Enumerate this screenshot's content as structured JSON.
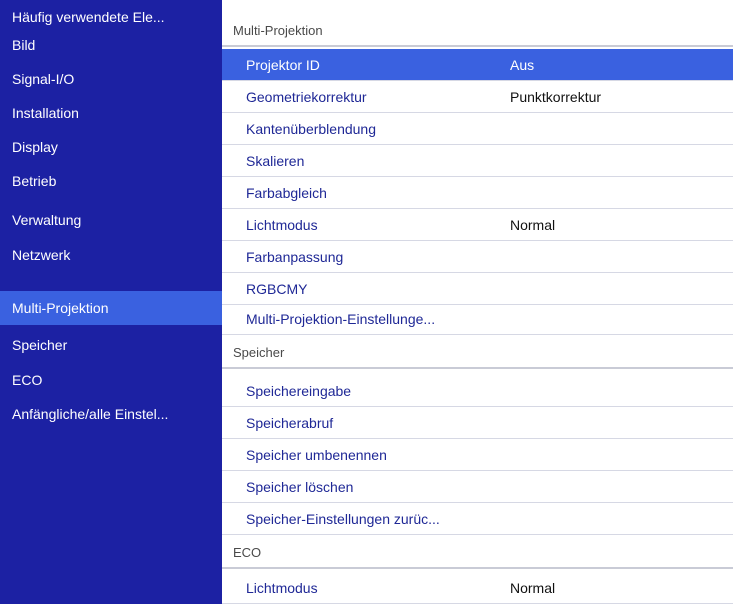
{
  "sidebar": {
    "items": [
      {
        "label": "Häufig verwendete Ele..."
      },
      {
        "label": "Bild"
      },
      {
        "label": "Signal-I/O"
      },
      {
        "label": "Installation"
      },
      {
        "label": "Display"
      },
      {
        "label": "Betrieb"
      },
      {
        "label": "Verwaltung"
      },
      {
        "label": "Netzwerk"
      },
      {
        "label": "Multi-Projektion",
        "active": true
      },
      {
        "label": "Speicher"
      },
      {
        "label": "ECO"
      },
      {
        "label": "Anfängliche/alle Einstel..."
      }
    ]
  },
  "main": {
    "sections": [
      {
        "title": "Multi-Projektion",
        "items": [
          {
            "label": "Projektor ID",
            "value": "Aus",
            "selected": true
          },
          {
            "label": "Geometriekorrektur",
            "value": "Punktkorrektur"
          },
          {
            "label": "Kantenüberblendung",
            "value": ""
          },
          {
            "label": "Skalieren",
            "value": ""
          },
          {
            "label": "Farbabgleich",
            "value": ""
          },
          {
            "label": "Lichtmodus",
            "value": "Normal"
          },
          {
            "label": "Farbanpassung",
            "value": ""
          },
          {
            "label": "RGBCMY",
            "value": ""
          },
          {
            "label": "Multi-Projektion-Einstellunge...",
            "value": ""
          }
        ]
      },
      {
        "title": "Speicher",
        "items": [
          {
            "label": "Speichereingabe",
            "value": ""
          },
          {
            "label": "Speicherabruf",
            "value": ""
          },
          {
            "label": "Speicher umbenennen",
            "value": ""
          },
          {
            "label": "Speicher löschen",
            "value": ""
          },
          {
            "label": "Speicher-Einstellungen zurüc...",
            "value": ""
          }
        ]
      },
      {
        "title": "ECO",
        "items": [
          {
            "label": "Lichtmodus",
            "value": "Normal"
          }
        ]
      }
    ]
  },
  "colors": {
    "sidebar_bg": "#1c21a3",
    "highlight": "#3a61e0",
    "item_text": "#1f2896"
  }
}
